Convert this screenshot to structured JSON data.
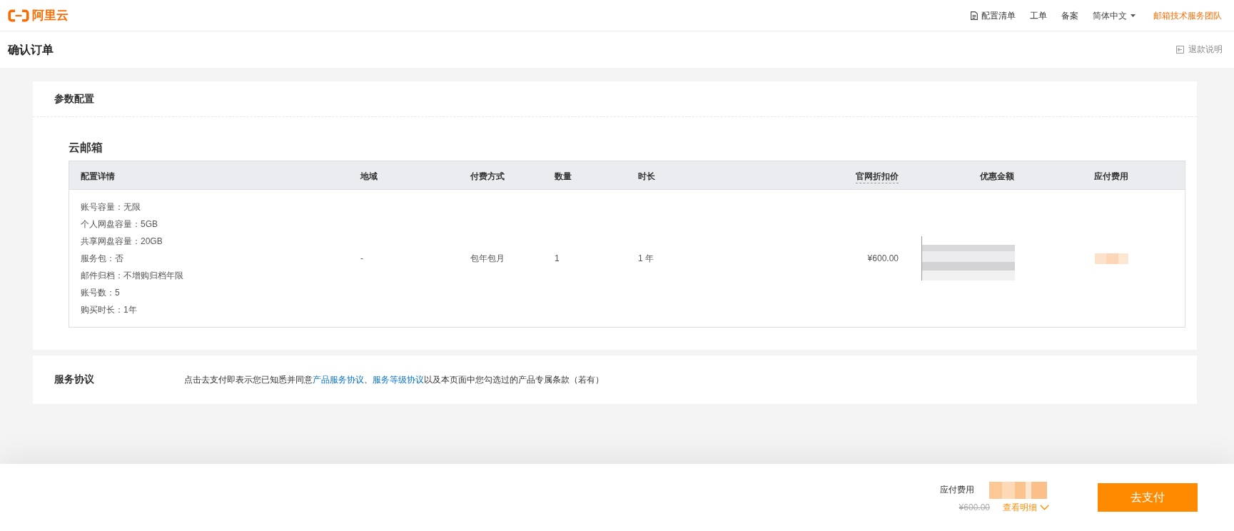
{
  "top_nav": {
    "logo": "阿里云",
    "links": [
      {
        "label": "配置清单",
        "kind": "document"
      },
      {
        "label": "工单",
        "kind": "plain"
      },
      {
        "label": "备案",
        "kind": "plain"
      },
      {
        "label": "简体中文",
        "kind": "dropdown"
      },
      {
        "label": "邮箱技术服务团队",
        "kind": "account"
      }
    ]
  },
  "page_header": {
    "title": "确认订单",
    "refund_link": "退款说明"
  },
  "config_card": {
    "title": "参数配置",
    "product_name": "云邮箱",
    "table": {
      "columns": [
        {
          "label": "配置详情",
          "tooltip": false
        },
        {
          "label": "地域",
          "tooltip": false
        },
        {
          "label": "付费方式",
          "tooltip": false
        },
        {
          "label": "数量",
          "tooltip": false
        },
        {
          "label": "时长",
          "tooltip": false
        },
        {
          "label": "官网折扣价",
          "tooltip": true
        },
        {
          "label": "优惠金额",
          "tooltip": false
        },
        {
          "label": "应付费用",
          "tooltip": false
        }
      ],
      "rows": [
        {
          "details": [
            "账号容量：无限",
            "个人网盘容量：5GB",
            "共享网盘容量：20GB",
            "服务包：否",
            "邮件归档：不增购归档年限",
            "账号数：5",
            "购买时长：1年"
          ],
          "region": "-",
          "billing": "包年包月",
          "quantity": "1",
          "duration": "1 年",
          "list_price": "¥600.00"
        }
      ]
    }
  },
  "agreement_card": {
    "title": "服务协议",
    "text_parts": [
      {
        "kind": "plain",
        "text": "点击去支付即表示您已知悉并同意"
      },
      {
        "kind": "link",
        "text": "产品服务协议"
      },
      {
        "kind": "plain",
        "text": "、"
      },
      {
        "kind": "link",
        "text": "服务等级协议"
      },
      {
        "kind": "plain",
        "text": "以及本页面中您勾选过的产品专属条款（若有）"
      }
    ]
  },
  "checkout_bar": {
    "total_label": "应付费用",
    "original_price": "¥600.00",
    "details_link": "查看明细",
    "pay_button": "去支付"
  }
}
